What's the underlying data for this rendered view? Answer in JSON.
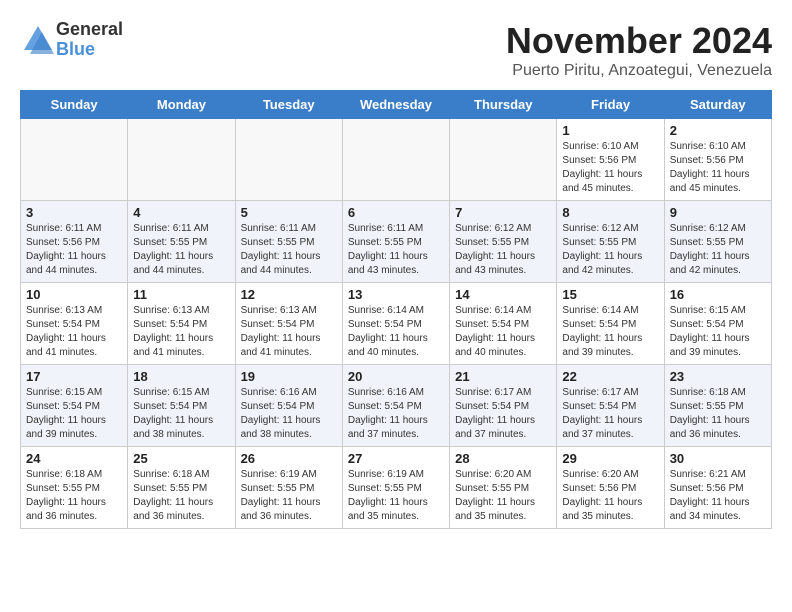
{
  "header": {
    "logo_line1": "General",
    "logo_line2": "Blue",
    "title": "November 2024",
    "location": "Puerto Piritu, Anzoategui, Venezuela"
  },
  "weekdays": [
    "Sunday",
    "Monday",
    "Tuesday",
    "Wednesday",
    "Thursday",
    "Friday",
    "Saturday"
  ],
  "weeks": [
    [
      {
        "day": "",
        "detail": ""
      },
      {
        "day": "",
        "detail": ""
      },
      {
        "day": "",
        "detail": ""
      },
      {
        "day": "",
        "detail": ""
      },
      {
        "day": "",
        "detail": ""
      },
      {
        "day": "1",
        "detail": "Sunrise: 6:10 AM\nSunset: 5:56 PM\nDaylight: 11 hours and 45 minutes."
      },
      {
        "day": "2",
        "detail": "Sunrise: 6:10 AM\nSunset: 5:56 PM\nDaylight: 11 hours and 45 minutes."
      }
    ],
    [
      {
        "day": "3",
        "detail": "Sunrise: 6:11 AM\nSunset: 5:56 PM\nDaylight: 11 hours and 44 minutes."
      },
      {
        "day": "4",
        "detail": "Sunrise: 6:11 AM\nSunset: 5:55 PM\nDaylight: 11 hours and 44 minutes."
      },
      {
        "day": "5",
        "detail": "Sunrise: 6:11 AM\nSunset: 5:55 PM\nDaylight: 11 hours and 44 minutes."
      },
      {
        "day": "6",
        "detail": "Sunrise: 6:11 AM\nSunset: 5:55 PM\nDaylight: 11 hours and 43 minutes."
      },
      {
        "day": "7",
        "detail": "Sunrise: 6:12 AM\nSunset: 5:55 PM\nDaylight: 11 hours and 43 minutes."
      },
      {
        "day": "8",
        "detail": "Sunrise: 6:12 AM\nSunset: 5:55 PM\nDaylight: 11 hours and 42 minutes."
      },
      {
        "day": "9",
        "detail": "Sunrise: 6:12 AM\nSunset: 5:55 PM\nDaylight: 11 hours and 42 minutes."
      }
    ],
    [
      {
        "day": "10",
        "detail": "Sunrise: 6:13 AM\nSunset: 5:54 PM\nDaylight: 11 hours and 41 minutes."
      },
      {
        "day": "11",
        "detail": "Sunrise: 6:13 AM\nSunset: 5:54 PM\nDaylight: 11 hours and 41 minutes."
      },
      {
        "day": "12",
        "detail": "Sunrise: 6:13 AM\nSunset: 5:54 PM\nDaylight: 11 hours and 41 minutes."
      },
      {
        "day": "13",
        "detail": "Sunrise: 6:14 AM\nSunset: 5:54 PM\nDaylight: 11 hours and 40 minutes."
      },
      {
        "day": "14",
        "detail": "Sunrise: 6:14 AM\nSunset: 5:54 PM\nDaylight: 11 hours and 40 minutes."
      },
      {
        "day": "15",
        "detail": "Sunrise: 6:14 AM\nSunset: 5:54 PM\nDaylight: 11 hours and 39 minutes."
      },
      {
        "day": "16",
        "detail": "Sunrise: 6:15 AM\nSunset: 5:54 PM\nDaylight: 11 hours and 39 minutes."
      }
    ],
    [
      {
        "day": "17",
        "detail": "Sunrise: 6:15 AM\nSunset: 5:54 PM\nDaylight: 11 hours and 39 minutes."
      },
      {
        "day": "18",
        "detail": "Sunrise: 6:15 AM\nSunset: 5:54 PM\nDaylight: 11 hours and 38 minutes."
      },
      {
        "day": "19",
        "detail": "Sunrise: 6:16 AM\nSunset: 5:54 PM\nDaylight: 11 hours and 38 minutes."
      },
      {
        "day": "20",
        "detail": "Sunrise: 6:16 AM\nSunset: 5:54 PM\nDaylight: 11 hours and 37 minutes."
      },
      {
        "day": "21",
        "detail": "Sunrise: 6:17 AM\nSunset: 5:54 PM\nDaylight: 11 hours and 37 minutes."
      },
      {
        "day": "22",
        "detail": "Sunrise: 6:17 AM\nSunset: 5:54 PM\nDaylight: 11 hours and 37 minutes."
      },
      {
        "day": "23",
        "detail": "Sunrise: 6:18 AM\nSunset: 5:55 PM\nDaylight: 11 hours and 36 minutes."
      }
    ],
    [
      {
        "day": "24",
        "detail": "Sunrise: 6:18 AM\nSunset: 5:55 PM\nDaylight: 11 hours and 36 minutes."
      },
      {
        "day": "25",
        "detail": "Sunrise: 6:18 AM\nSunset: 5:55 PM\nDaylight: 11 hours and 36 minutes."
      },
      {
        "day": "26",
        "detail": "Sunrise: 6:19 AM\nSunset: 5:55 PM\nDaylight: 11 hours and 36 minutes."
      },
      {
        "day": "27",
        "detail": "Sunrise: 6:19 AM\nSunset: 5:55 PM\nDaylight: 11 hours and 35 minutes."
      },
      {
        "day": "28",
        "detail": "Sunrise: 6:20 AM\nSunset: 5:55 PM\nDaylight: 11 hours and 35 minutes."
      },
      {
        "day": "29",
        "detail": "Sunrise: 6:20 AM\nSunset: 5:56 PM\nDaylight: 11 hours and 35 minutes."
      },
      {
        "day": "30",
        "detail": "Sunrise: 6:21 AM\nSunset: 5:56 PM\nDaylight: 11 hours and 34 minutes."
      }
    ]
  ]
}
